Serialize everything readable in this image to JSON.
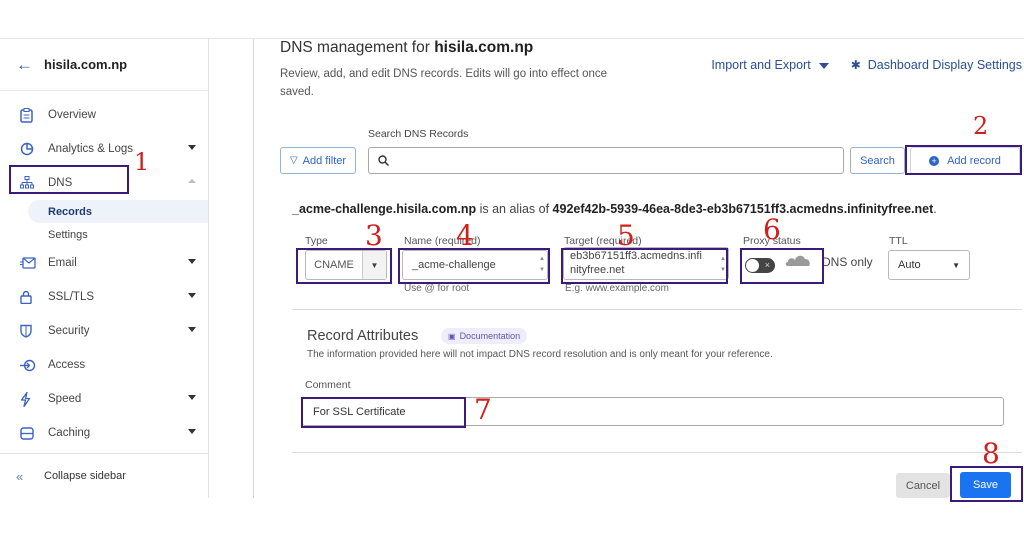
{
  "sidebar": {
    "domain": "hisila.com.np",
    "back_icon": "arrow-left-icon",
    "items": [
      {
        "label": "Overview",
        "icon": "clipboard-icon",
        "expandable": false
      },
      {
        "label": "Analytics & Logs",
        "icon": "pie-chart-icon",
        "expandable": true
      },
      {
        "label": "DNS",
        "icon": "network-icon",
        "expandable": true,
        "expanded": true,
        "children": [
          {
            "label": "Records",
            "active": true
          },
          {
            "label": "Settings",
            "active": false
          }
        ]
      },
      {
        "label": "Email",
        "icon": "email-icon",
        "expandable": true
      },
      {
        "label": "SSL/TLS",
        "icon": "lock-icon",
        "expandable": true
      },
      {
        "label": "Security",
        "icon": "shield-icon",
        "expandable": true
      },
      {
        "label": "Access",
        "icon": "access-icon",
        "expandable": false
      },
      {
        "label": "Speed",
        "icon": "lightning-icon",
        "expandable": true
      },
      {
        "label": "Caching",
        "icon": "server-icon",
        "expandable": true
      }
    ],
    "collapse_label": "Collapse sidebar"
  },
  "header": {
    "title_prefix": "DNS management for ",
    "title_domain": "hisila.com.np",
    "subtitle": "Review, add, and edit DNS records. Edits will go into effect once saved.",
    "import_export": "Import and Export",
    "display_settings": "Dashboard Display Settings"
  },
  "toolbar": {
    "add_filter": "Add filter",
    "search_label": "Search DNS Records",
    "search_value": "",
    "search_button": "Search",
    "add_record": "Add record"
  },
  "record": {
    "alias_name": "_acme-challenge.hisila.com.np",
    "alias_mid": " is an alias of ",
    "alias_target": "492ef42b-5939-46ea-8de3-eb3b67151ff3.acmedns.infinityfree.net",
    "alias_end": ".",
    "type_label": "Type",
    "type_value": "CNAME",
    "name_label": "Name (required)",
    "name_value": "_acme-challenge",
    "name_hint": "Use @ for root",
    "target_label": "Target (required)",
    "target_value_line1": "eb3b67151ff3.acmedns.infi",
    "target_value_line2": "nityfree.net",
    "target_hint": "E.g. www.example.com",
    "proxy_label": "Proxy status",
    "proxy_enabled": false,
    "proxy_text": "DNS only",
    "ttl_label": "TTL",
    "ttl_value": "Auto"
  },
  "attributes": {
    "title": "Record Attributes",
    "doc_badge": "Documentation",
    "description": "The information provided here will not impact DNS record resolution and is only meant for your reference.",
    "comment_label": "Comment",
    "comment_value": "For SSL Certificate"
  },
  "actions": {
    "cancel": "Cancel",
    "save": "Save"
  },
  "annotations": [
    "1",
    "2",
    "3",
    "4",
    "5",
    "6",
    "7",
    "8"
  ],
  "colors": {
    "accent": "#1a73f0",
    "link": "#2a4f96",
    "annotation_box": "#3b1a7a",
    "annotation_number": "#d1201b"
  }
}
